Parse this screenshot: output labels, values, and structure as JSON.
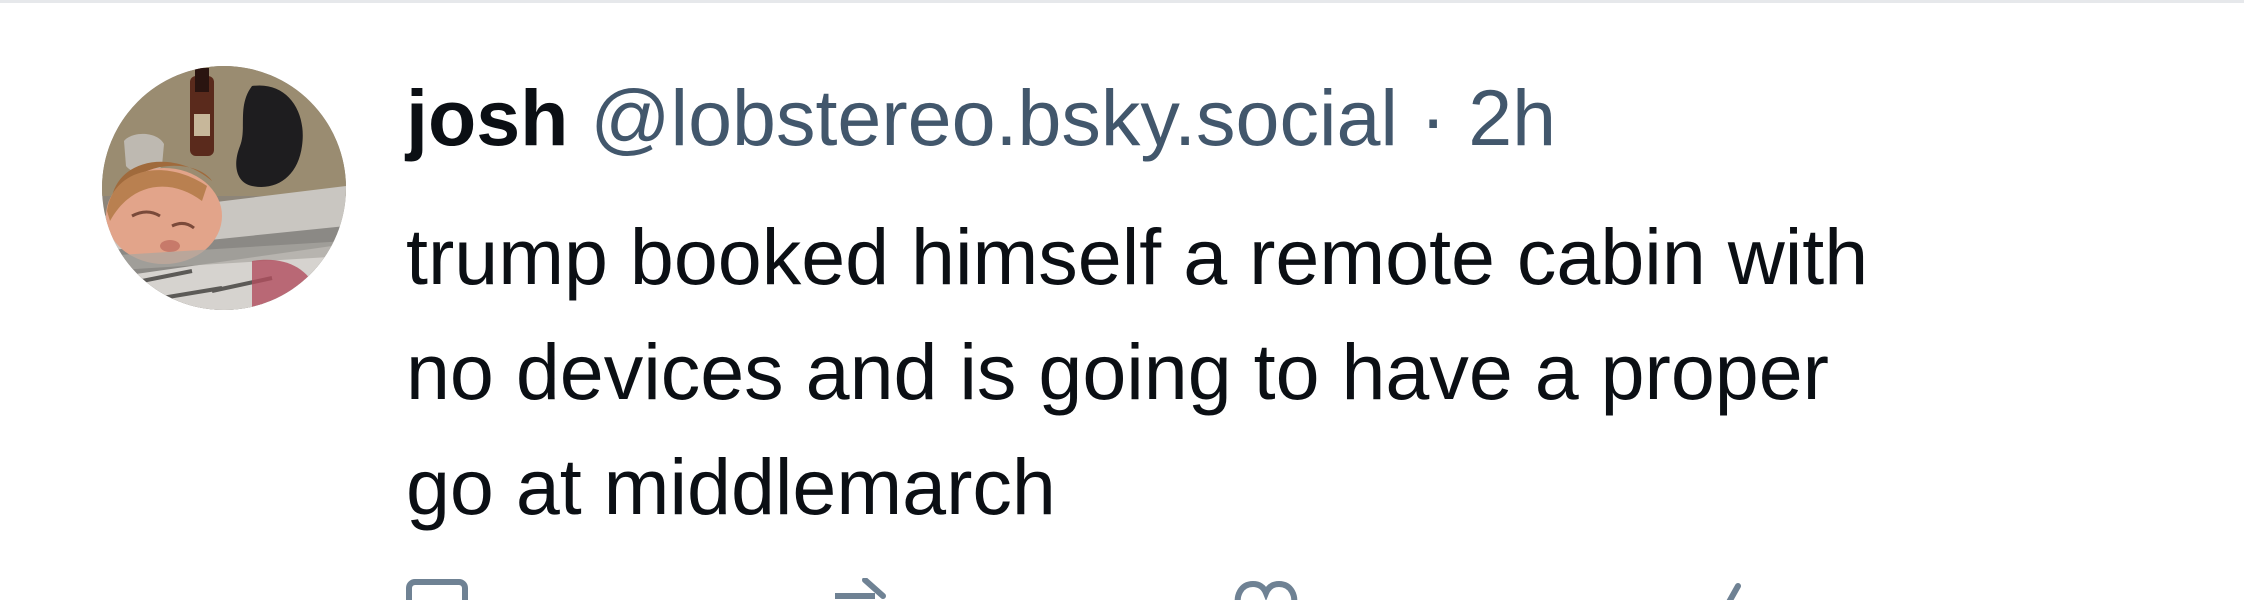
{
  "post": {
    "author": {
      "name": "josh",
      "handle": "@lobstereo.bsky.social",
      "avatar_icon": "user-avatar-photo"
    },
    "separator": "·",
    "time": "2h",
    "text_lines": [
      "trump booked himself a remote cabin with",
      "no devices and is going to have a proper",
      "go at middlemarch"
    ],
    "actions": [
      {
        "name": "reply",
        "icon": "reply-icon"
      },
      {
        "name": "repost",
        "icon": "repost-icon"
      },
      {
        "name": "like",
        "icon": "heart-icon"
      },
      {
        "name": "more",
        "icon": "more-icon"
      }
    ]
  },
  "colors": {
    "text_primary": "#0b0f14",
    "text_secondary": "#42576c",
    "divider": "#e6e8eb"
  }
}
